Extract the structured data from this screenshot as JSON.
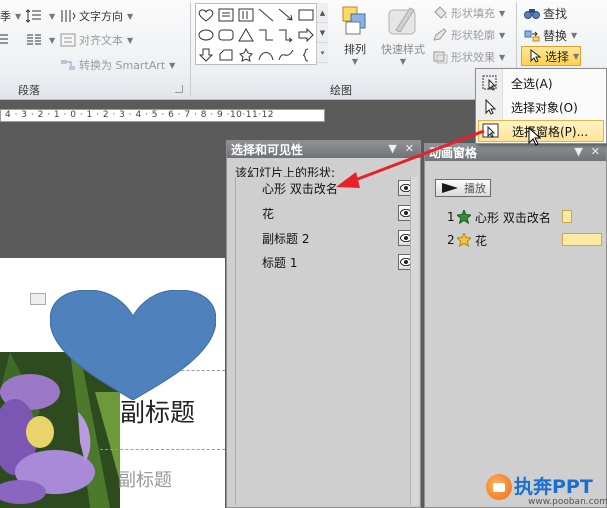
{
  "ribbon": {
    "paragraph": {
      "partial_label": "季",
      "text_direction": "文字方向",
      "align_text": "对齐文本",
      "convert_smartart": "转换为 SmartArt",
      "group_label": "段落"
    },
    "drawing": {
      "arrange": "排列",
      "quick_styles": "快速样式",
      "shape_fill": "形状填充",
      "shape_outline": "形状轮廓",
      "shape_effects": "形状效果",
      "group_label": "绘图"
    },
    "editing": {
      "find": "查找",
      "replace": "替换",
      "select": "选择"
    }
  },
  "select_menu": {
    "items": [
      {
        "label": "全选(A)"
      },
      {
        "label": "选择对象(O)"
      },
      {
        "label": "选择窗格(P)..."
      }
    ]
  },
  "ruler": {
    "labels": "4 · 3 · 2 · 1 · 0 · 1 · 2 · 3 · 4 · 5 · 6 · 7 · 8 · 9 ·10·11·12"
  },
  "slide": {
    "title_partial": "副标题",
    "subtitle_partial": "副标题"
  },
  "selection_pane": {
    "title": "选择和可见性",
    "caption": "该幻灯片上的形状:",
    "shapes": [
      {
        "name": "心形  双击改名"
      },
      {
        "name": "花"
      },
      {
        "name": "副标题 2"
      },
      {
        "name": "标题 1"
      }
    ]
  },
  "animation_pane": {
    "title": "动画窗格",
    "play": "播放",
    "items": [
      {
        "num": "1",
        "name": "心形  双击改名"
      },
      {
        "num": "2",
        "name": "花"
      }
    ]
  },
  "colors": {
    "heart": "#4f81bd",
    "arrow": "#e8202a",
    "highlight": "#ffe493",
    "timebar": "#fde9a4"
  },
  "watermark": {
    "brand": "执奔PPT",
    "url": "www.pooban.com"
  }
}
